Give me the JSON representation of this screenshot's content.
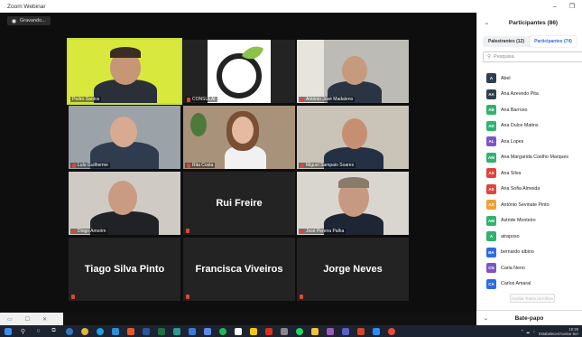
{
  "window": {
    "title": "Zoom Webinar",
    "minimize": "–",
    "restore": "❐"
  },
  "recording": {
    "label": "Gravando..."
  },
  "tiles": [
    {
      "name": "Pedro Santos",
      "type": "video",
      "active": true
    },
    {
      "name": "CONSULAI",
      "type": "logo"
    },
    {
      "name": "António José Madaleno",
      "type": "video"
    },
    {
      "name": "Luís Guilherme",
      "type": "video"
    },
    {
      "name": "Rita Costa",
      "type": "video"
    },
    {
      "name": "Miguel Sampaio Soares",
      "type": "video"
    },
    {
      "name": "Diogo Amorim",
      "type": "video"
    },
    {
      "name": "Rui Freire",
      "type": "name"
    },
    {
      "name": "José Pereira Palha",
      "type": "video"
    },
    {
      "name": "Tiago Silva Pinto",
      "type": "name"
    },
    {
      "name": "Francisca Viveiros",
      "type": "name"
    },
    {
      "name": "Jorge Neves",
      "type": "name"
    }
  ],
  "sidebar": {
    "title": "Participantes (86)",
    "tabs": [
      {
        "label": "Palestrantes (12)",
        "active": false
      },
      {
        "label": "Participantes (74)",
        "active": true
      }
    ],
    "search_placeholder": "Pesquisa",
    "participants": [
      {
        "initials": "A",
        "name": "Abel",
        "color": "#2d3e50"
      },
      {
        "initials": "AA",
        "name": "Ana Azevedo Pita",
        "color": "#2d3e50"
      },
      {
        "initials": "AB",
        "name": "Ana Barroso",
        "color": "#2fb36e"
      },
      {
        "initials": "AD",
        "name": "Ana Dulce Matins",
        "color": "#2fb36e"
      },
      {
        "initials": "AL",
        "name": "Ana Lopes",
        "color": "#7d55c7"
      },
      {
        "initials": "AM",
        "name": "Ana Margarida Coelho Marques",
        "color": "#2fb36e"
      },
      {
        "initials": "AS",
        "name": "Ana Silva",
        "color": "#e0443a"
      },
      {
        "initials": "AS",
        "name": "Ana Sofia Almeida",
        "color": "#e0443a"
      },
      {
        "initials": "AS",
        "name": "António Sevinate Pinto",
        "color": "#f0a030"
      },
      {
        "initials": "AM",
        "name": "Astride Monteiro",
        "color": "#2fb36e"
      },
      {
        "initials": "A",
        "name": "atraposo",
        "color": "#2fb36e"
      },
      {
        "initials": "BA",
        "name": "bernardo albino",
        "color": "#2d6cdf"
      },
      {
        "initials": "CN",
        "name": "Carla Neno",
        "color": "#7d55c7"
      },
      {
        "initials": "CA",
        "name": "Carlos Amaral",
        "color": "#2d6cdf"
      }
    ],
    "allow_all": "Aceitar Todos os Filhos",
    "chat": "Bate-papo"
  },
  "taskbar": {
    "time": "10:28",
    "date": "15/06/2020",
    "tray_label": "Estabelecer/Aceitar Ser"
  }
}
